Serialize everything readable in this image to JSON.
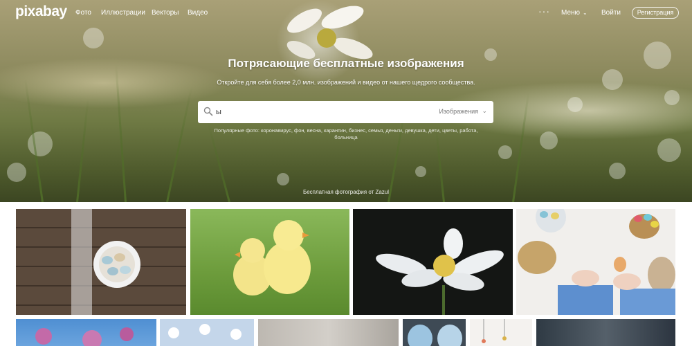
{
  "app": {
    "logo": "pixabay"
  },
  "nav": {
    "items": [
      {
        "label": "Фото"
      },
      {
        "label": "Иллюстрации"
      },
      {
        "label": "Векторы"
      },
      {
        "label": "Видео"
      }
    ],
    "more": "···",
    "menu": "Меню",
    "login": "Войти",
    "register": "Регистрация"
  },
  "hero": {
    "title": "Потрясающие бесплатные изображения",
    "subtitle": "Откройте для себя более 2,0 млн. изображений и видео от нашего щедрого сообщества.",
    "search": {
      "value": "ы",
      "type": "Изображения"
    },
    "popular": "Популярные фото: коронавирус, фон, весна, карантин, бизнес, семья, деньги, девушка, дети, цветы, работа, больница",
    "credit": "Бесплатная фотография от Zazul"
  },
  "colors": {
    "accent": "#ffffff",
    "search_bg": "#ffffff"
  },
  "gallery": {
    "row1": [
      "eggs-on-wood",
      "chicks-on-grass",
      "white-flower",
      "easter-table"
    ],
    "row2": [
      "pink-flowers",
      "bunny-pattern",
      "wood-texture",
      "blue-eggs",
      "hanging-decor",
      "dark-photo"
    ]
  }
}
